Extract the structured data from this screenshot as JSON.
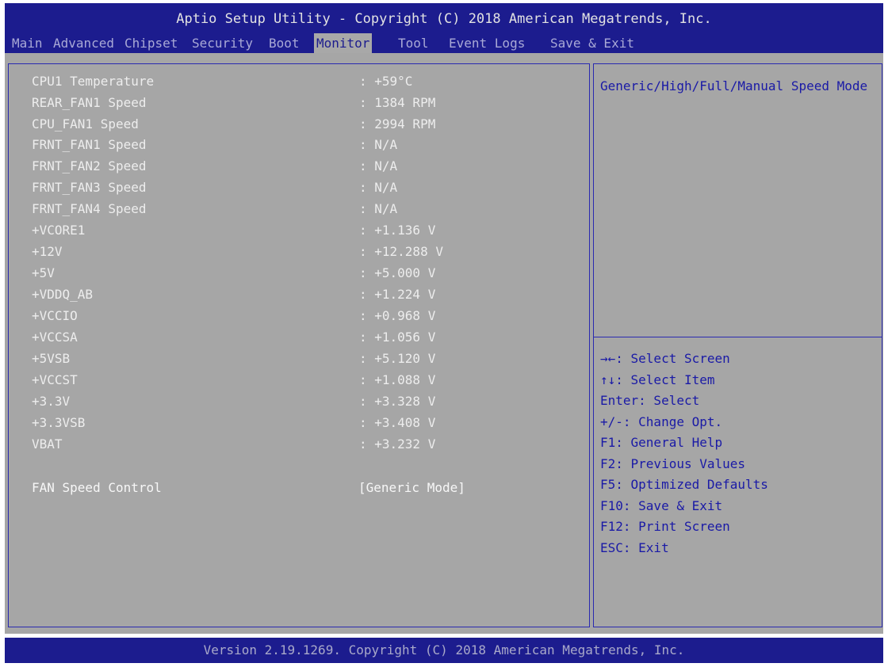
{
  "header": {
    "title": "Aptio Setup Utility - Copyright (C) 2018 American Megatrends, Inc.",
    "tabs": [
      {
        "label": "Main"
      },
      {
        "label": "Advanced"
      },
      {
        "label": "Chipset"
      },
      {
        "label": "Security"
      },
      {
        "label": "Boot"
      },
      {
        "label": "Monitor",
        "active": true
      },
      {
        "label": "Tool"
      },
      {
        "label": "Event Logs"
      },
      {
        "label": "Save & Exit"
      }
    ]
  },
  "monitor": {
    "readings": [
      {
        "label": "CPU1 Temperature",
        "value": ": +59°C"
      },
      {
        "label": "REAR_FAN1 Speed",
        "value": ": 1384 RPM"
      },
      {
        "label": "CPU_FAN1 Speed",
        "value": ": 2994 RPM"
      },
      {
        "label": "FRNT_FAN1 Speed",
        "value": ": N/A"
      },
      {
        "label": "FRNT_FAN2 Speed",
        "value": ": N/A"
      },
      {
        "label": "FRNT_FAN3 Speed",
        "value": ": N/A"
      },
      {
        "label": "FRNT_FAN4 Speed",
        "value": ": N/A"
      },
      {
        "label": "+VCORE1",
        "value": ": +1.136 V"
      },
      {
        "label": "+12V",
        "value": ": +12.288 V"
      },
      {
        "label": "+5V",
        "value": ": +5.000 V"
      },
      {
        "label": "+VDDQ_AB",
        "value": ": +1.224 V"
      },
      {
        "label": "+VCCIO",
        "value": ": +0.968 V"
      },
      {
        "label": "+VCCSA",
        "value": ": +1.056 V"
      },
      {
        "label": "+5VSB",
        "value": ": +5.120 V"
      },
      {
        "label": "+VCCST",
        "value": ": +1.088 V"
      },
      {
        "label": "+3.3V",
        "value": ": +3.328 V"
      },
      {
        "label": "+3.3VSB",
        "value": ": +3.408 V"
      },
      {
        "label": "VBAT",
        "value": ": +3.232 V"
      }
    ],
    "fan_control": {
      "label": "FAN Speed Control",
      "value": "[Generic Mode]"
    }
  },
  "help": {
    "description": "Generic/High/Full/Manual Speed Mode",
    "keys": [
      "→←: Select Screen",
      "↑↓: Select Item",
      "Enter: Select",
      "+/-: Change Opt.",
      "F1: General Help",
      "F2: Previous Values",
      "F5: Optimized Defaults",
      "F10: Save & Exit",
      "F12: Print Screen",
      "ESC: Exit"
    ]
  },
  "footer": {
    "text": "Version 2.19.1269. Copyright (C) 2018 American Megatrends, Inc."
  },
  "colors": {
    "header_bg": "#1c1c8e",
    "body_bg": "#a6a6a6",
    "help_text": "#1a1aa6",
    "item_text": "#ededed"
  }
}
